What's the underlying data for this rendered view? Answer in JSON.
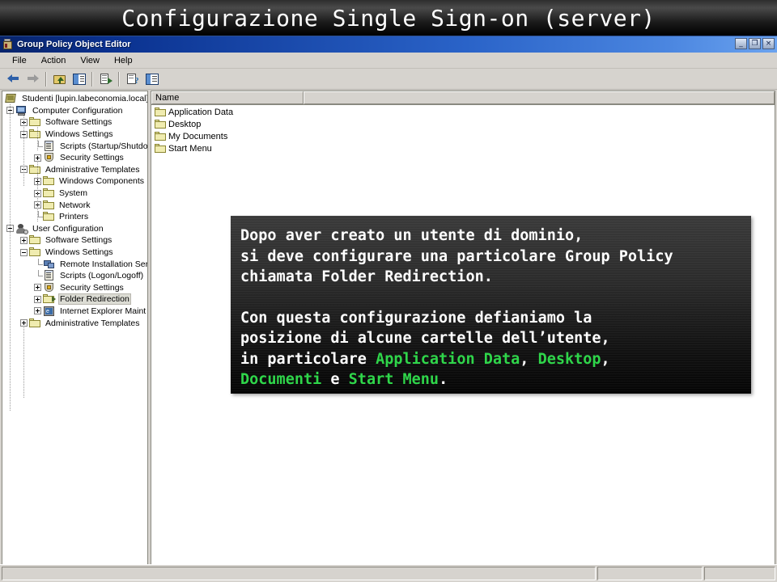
{
  "banner": {
    "title": "Configurazione Single Sign-on (server)"
  },
  "window": {
    "title": "Group Policy Object Editor",
    "icon": "gpo-icon",
    "controls": {
      "minimize": "_",
      "restore": "❐",
      "close": "×"
    }
  },
  "menu": {
    "items": [
      {
        "label": "File"
      },
      {
        "label": "Action"
      },
      {
        "label": "View"
      },
      {
        "label": "Help"
      }
    ]
  },
  "toolbar": {
    "buttons": [
      {
        "name": "back-button",
        "icon": "arrow-left-icon"
      },
      {
        "name": "forward-button",
        "icon": "arrow-right-icon"
      },
      {
        "name": "up-one-level-button",
        "icon": "folder-up-icon"
      },
      {
        "name": "show-hide-tree-button",
        "icon": "split-panes-icon"
      },
      {
        "name": "export-list-button",
        "icon": "export-document-icon"
      },
      {
        "name": "help-button",
        "icon": "help-document-icon"
      },
      {
        "name": "properties-button",
        "icon": "properties-icon"
      }
    ]
  },
  "tree": {
    "root": {
      "label": "Studenti [lupin.labeconomia.local] F",
      "icon": "gpo-icon"
    },
    "nodes": [
      {
        "label": "Computer Configuration",
        "icon": "computer-icon",
        "depth": 0,
        "expander": "minus"
      },
      {
        "label": "Software Settings",
        "icon": "folder-icon",
        "depth": 1,
        "expander": "plus"
      },
      {
        "label": "Windows Settings",
        "icon": "folder-icon",
        "depth": 1,
        "expander": "minus"
      },
      {
        "label": "Scripts (Startup/Shutdo",
        "icon": "script-icon",
        "depth": 2,
        "expander": "none"
      },
      {
        "label": "Security Settings",
        "icon": "security-icon",
        "depth": 2,
        "expander": "plus"
      },
      {
        "label": "Administrative Templates",
        "icon": "folder-icon",
        "depth": 1,
        "expander": "minus"
      },
      {
        "label": "Windows Components",
        "icon": "folder-icon",
        "depth": 2,
        "expander": "plus"
      },
      {
        "label": "System",
        "icon": "folder-icon",
        "depth": 2,
        "expander": "plus"
      },
      {
        "label": "Network",
        "icon": "folder-icon",
        "depth": 2,
        "expander": "plus"
      },
      {
        "label": "Printers",
        "icon": "folder-icon",
        "depth": 2,
        "expander": "none"
      },
      {
        "label": "User Configuration",
        "icon": "user-icon",
        "depth": 0,
        "expander": "minus"
      },
      {
        "label": "Software Settings",
        "icon": "folder-icon",
        "depth": 1,
        "expander": "plus"
      },
      {
        "label": "Windows Settings",
        "icon": "folder-icon",
        "depth": 1,
        "expander": "minus"
      },
      {
        "label": "Remote Installation Ser",
        "icon": "remote-installation-icon",
        "depth": 2,
        "expander": "none"
      },
      {
        "label": "Scripts (Logon/Logoff)",
        "icon": "script-icon",
        "depth": 2,
        "expander": "none"
      },
      {
        "label": "Security Settings",
        "icon": "security-icon",
        "depth": 2,
        "expander": "plus"
      },
      {
        "label": "Folder Redirection",
        "icon": "folder-redirection-icon",
        "depth": 2,
        "expander": "plus",
        "selected": true
      },
      {
        "label": "Internet Explorer Maint",
        "icon": "internet-explorer-icon",
        "depth": 2,
        "expander": "plus"
      },
      {
        "label": "Administrative Templates",
        "icon": "folder-icon",
        "depth": 1,
        "expander": "plus"
      }
    ]
  },
  "list": {
    "columns": [
      "Name",
      ""
    ],
    "rows": [
      {
        "name": "Application Data",
        "icon": "folder-icon"
      },
      {
        "name": "Desktop",
        "icon": "folder-icon"
      },
      {
        "name": "My Documents",
        "icon": "folder-icon"
      },
      {
        "name": "Start Menu",
        "icon": "folder-icon"
      }
    ]
  },
  "statusbar": {
    "panel1": "",
    "panel2": "",
    "panel3": ""
  },
  "overlay": {
    "colors": {
      "highlight": "#2fd64a",
      "text": "#ffffff",
      "background": "#2b2b2b"
    },
    "paragraph1": {
      "line1": "Dopo aver creato un utente di dominio,",
      "line2": "si deve configurare una particolare Group Policy",
      "line3": "chiamata Folder Redirection."
    },
    "paragraph2": {
      "line1": "Con questa configurazione defianiamo la",
      "line2": "posizione di alcune cartelle dell’utente,",
      "line3_pre": "in particolare ",
      "hl1": "Application Data",
      "line3_mid": ", ",
      "hl2": "Desktop",
      "line3_post": ",",
      "hl3": "Documenti",
      "line4_mid": " e ",
      "hl4": "Start Menu",
      "line4_post": "."
    }
  }
}
